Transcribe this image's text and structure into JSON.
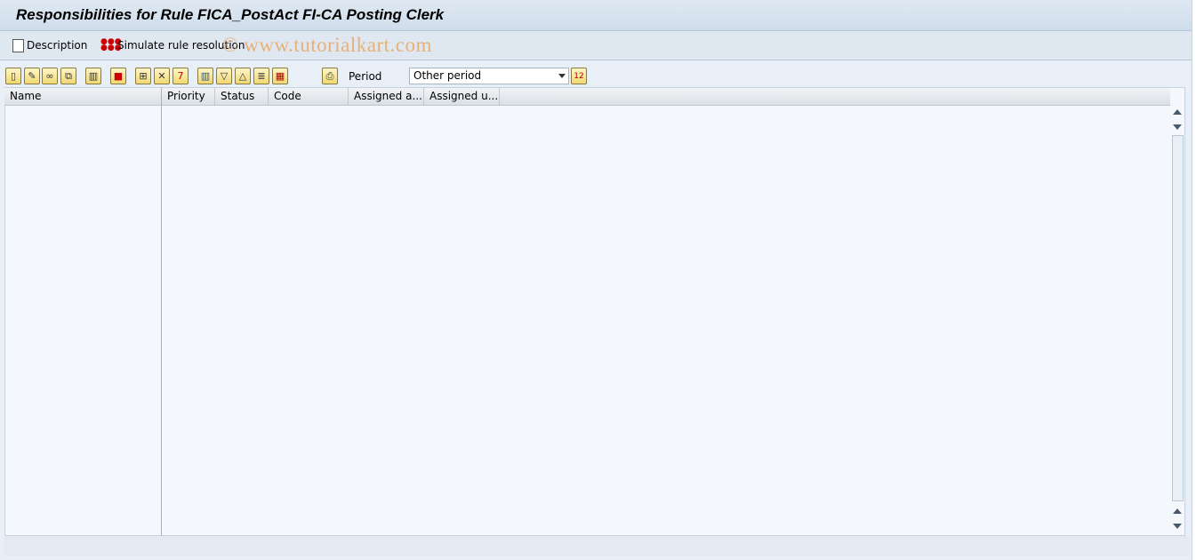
{
  "title": "Responsibilities for Rule FICA_PostAct FI-CA Posting Clerk",
  "app_toolbar": {
    "description": "Description",
    "simulate": "Simulate rule resolution"
  },
  "watermark": "© www.tutorialkart.com",
  "toolbar": {
    "buttons": [
      {
        "name": "create-icon",
        "glyph": "▯"
      },
      {
        "name": "change-icon",
        "glyph": "✎"
      },
      {
        "name": "display-icon",
        "glyph": "∞"
      },
      {
        "name": "copy-icon",
        "glyph": "⧉"
      },
      {
        "name": "delete-icon",
        "glyph": "🗑"
      },
      {
        "name": "transport-icon",
        "glyph": "⛟"
      },
      {
        "name": "assign-icon",
        "glyph": "⊞"
      },
      {
        "name": "remove-assignment-icon",
        "glyph": "✕"
      },
      {
        "name": "validity-icon",
        "glyph": "7"
      },
      {
        "name": "layout-icon",
        "glyph": "▥"
      },
      {
        "name": "expand-icon",
        "glyph": "▽"
      },
      {
        "name": "collapse-icon",
        "glyph": "△"
      },
      {
        "name": "details-icon",
        "glyph": "≣"
      },
      {
        "name": "column-settings-icon",
        "glyph": "▦"
      },
      {
        "name": "print-icon",
        "glyph": "⎙"
      }
    ],
    "period_label": "Period",
    "period_value": "Other period",
    "calendar_icon": "calendar-icon"
  },
  "columns": [
    "Name",
    "Priority",
    "Status",
    "Code",
    "Assigned a...",
    "Assigned u..."
  ],
  "colors": {
    "title_bg": "#dfe9f3",
    "grid_bg": "#f4f8fd",
    "button_bg": "#f0d874",
    "watermark": "#e8a45c"
  }
}
